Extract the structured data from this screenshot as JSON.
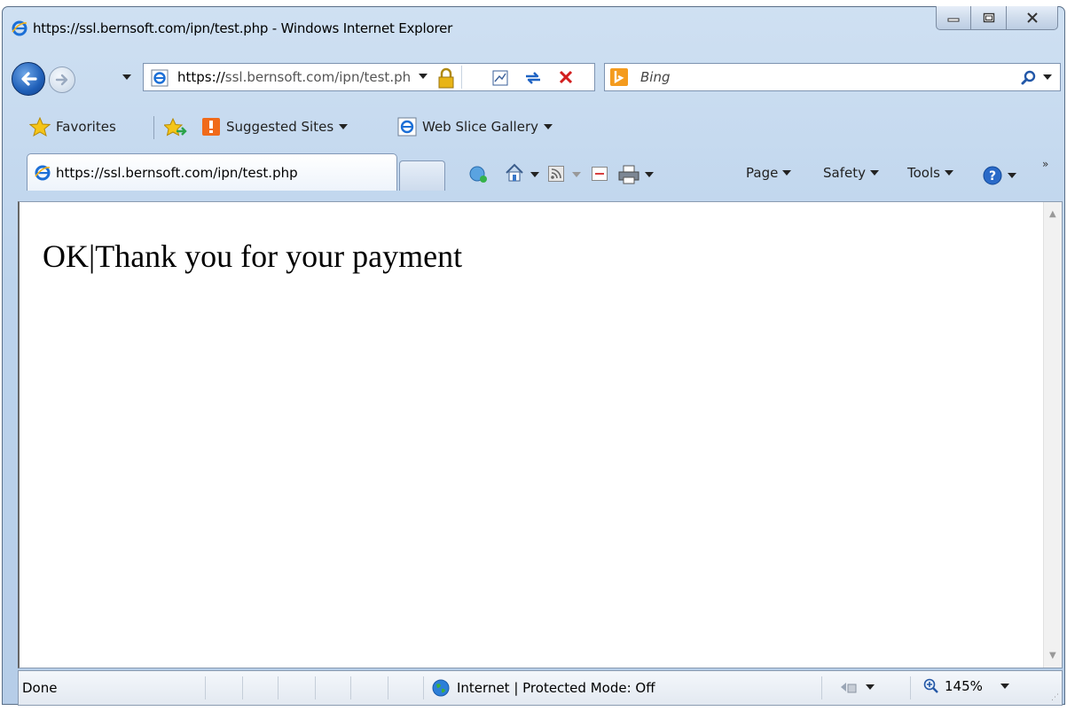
{
  "window": {
    "title": "https://ssl.bernsoft.com/ipn/test.php - Windows Internet Explorer"
  },
  "address_bar": {
    "url_scheme": "https://",
    "url_host": "ssl.bernsoft.com",
    "url_path": "/ipn/test.php"
  },
  "search": {
    "placeholder": "Bing"
  },
  "favorites_bar": {
    "favorites_label": "Favorites",
    "suggested_sites_label": "Suggested Sites",
    "web_slice_gallery_label": "Web Slice Gallery"
  },
  "tab": {
    "label": "https://ssl.bernsoft.com/ipn/test.php"
  },
  "command_bar": {
    "page_label": "Page",
    "safety_label": "Safety",
    "tools_label": "Tools"
  },
  "content": {
    "message": "OK|Thank you for your payment"
  },
  "status_bar": {
    "status_text": "Done",
    "zone_text": "Internet | Protected Mode: Off",
    "zoom_level": "145%"
  },
  "icons": [
    "ie-icon",
    "back-icon",
    "forward-icon",
    "lock-icon",
    "compat-view-icon",
    "refresh-icon",
    "stop-icon",
    "bing-icon",
    "search-icon",
    "star-icon",
    "add-favorites-icon",
    "suggested-sites-icon",
    "web-slice-icon",
    "feeds-icon",
    "home-icon",
    "rss-icon",
    "mail-icon",
    "print-icon",
    "help-icon",
    "globe-icon"
  ],
  "colors": {
    "frame": "#bcd3ec",
    "back_button": "#1f5fb8",
    "bing_orange": "#f49b1e",
    "stop_red": "#d21e1e"
  }
}
